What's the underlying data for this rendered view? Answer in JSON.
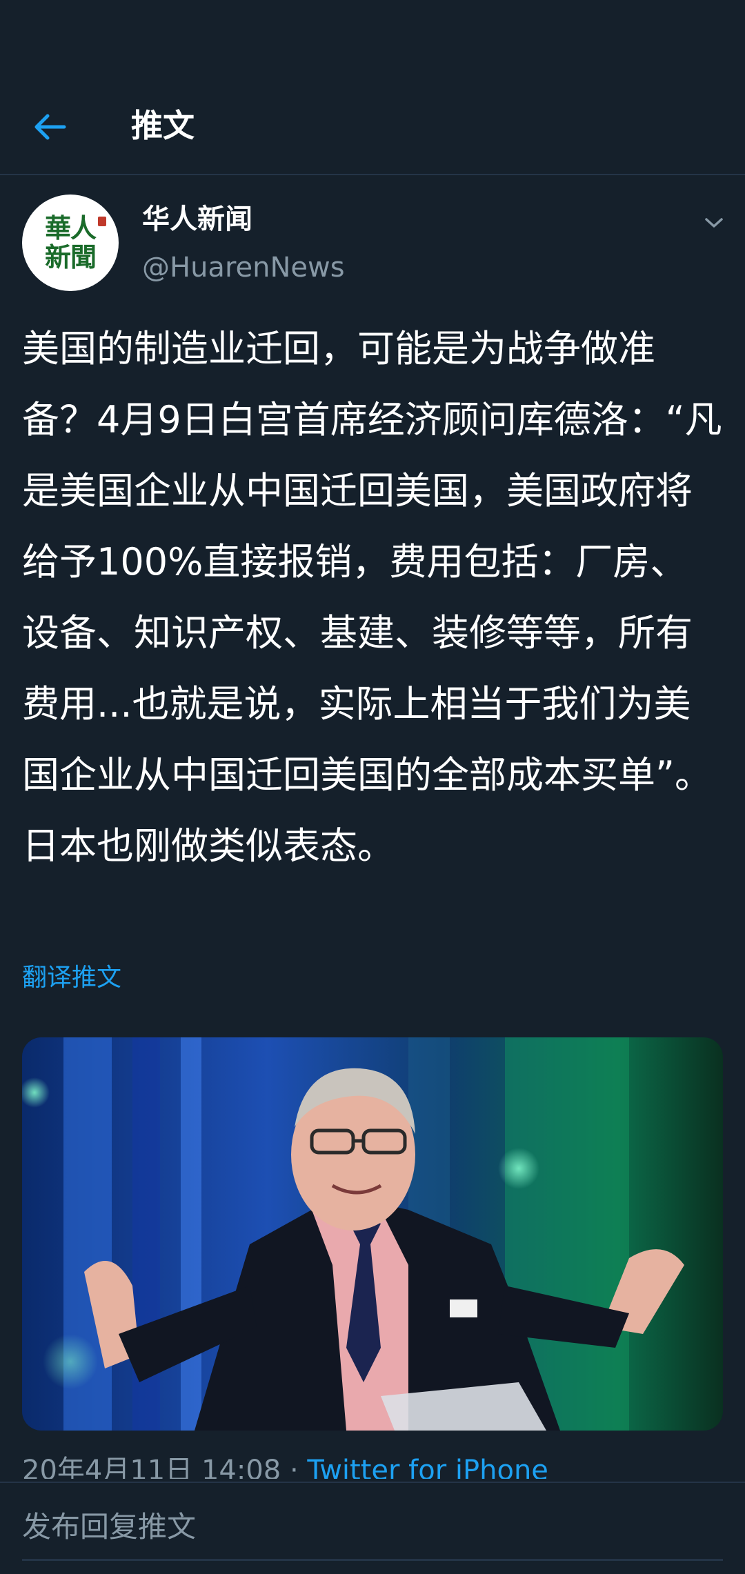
{
  "header": {
    "title": "推文"
  },
  "tweet": {
    "avatar": {
      "line1": "華人",
      "line2": "新聞"
    },
    "author_name": "华人新闻",
    "author_handle": "@HuarenNews",
    "text": "美国的制造业迁回，可能是为战争做准备？4月9日白宫首席经济顾问库德洛：“凡是美国企业从中国迁回美国，美国政府将给予100%直接报销，费用包括：厂房、设备、知识产权、基建、装修等等，所有费用...也就是说，实际上相当于我们为美国企业从中国迁回美国的全部成本买单”。日本也刚做类似表态。",
    "translate_label": "翻译推文",
    "timestamp": "20年4月11日  14:08 · ",
    "source": "Twitter for iPhone"
  },
  "reply": {
    "placeholder": "发布回复推文"
  },
  "colors": {
    "background": "#15202b",
    "accent": "#1da1f2",
    "secondary_text": "#8899a6",
    "divider": "#243447"
  },
  "icons": {
    "back": "arrow-left-icon",
    "caret": "chevron-down-icon"
  }
}
